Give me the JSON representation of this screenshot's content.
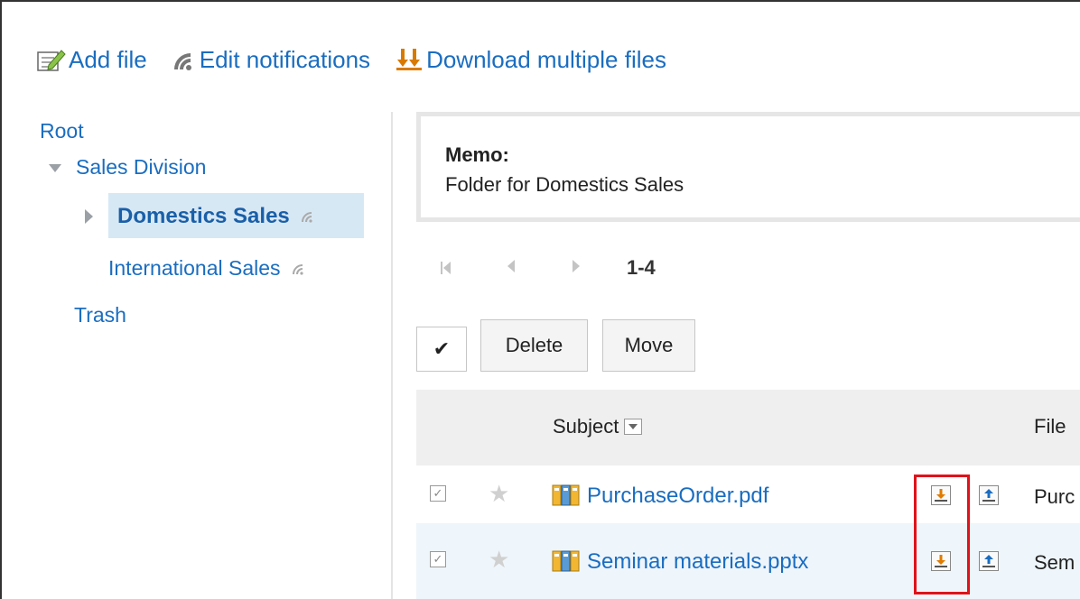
{
  "toolbar": {
    "add_file": "Add file",
    "edit_notifications": "Edit notifications",
    "download_multiple": "Download multiple files"
  },
  "tree": {
    "root": "Root",
    "sales_division": "Sales Division",
    "domestics_sales": "Domestics Sales",
    "international_sales": "International Sales",
    "trash": "Trash"
  },
  "memo": {
    "title": "Memo:",
    "text": "Folder for Domestics Sales"
  },
  "pager": {
    "range": "1-4"
  },
  "actions": {
    "check_all": "✔",
    "delete": "Delete",
    "move": "Move"
  },
  "table": {
    "columns": {
      "subject": "Subject",
      "file": "File"
    },
    "rows": [
      {
        "filename": "PurchaseOrder.pdf",
        "file_cell": "Purc"
      },
      {
        "filename": "Seminar materials.pptx",
        "file_cell": "Sem"
      }
    ]
  },
  "colors": {
    "link": "#1a6dc0",
    "selected_bg": "#d7e8f5",
    "highlight": "#e0121a"
  },
  "icons": [
    "add-file-icon",
    "notification-icon",
    "download-multiple-icon",
    "folder-triangle-icon",
    "file-type-icon",
    "download-icon",
    "upload-icon",
    "star-icon"
  ]
}
